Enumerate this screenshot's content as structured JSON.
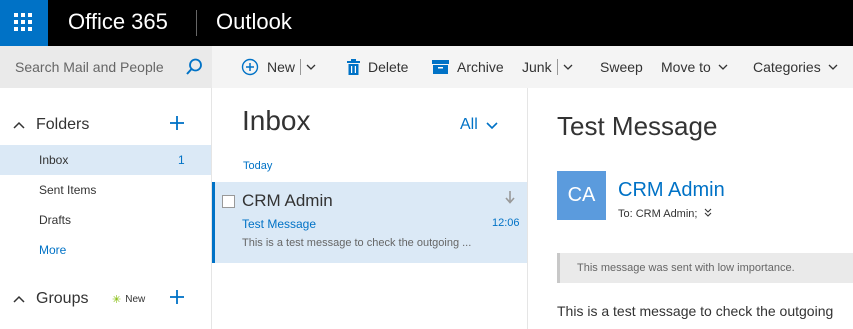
{
  "topbar": {
    "brand": "Office 365",
    "app_name": "Outlook",
    "waffle_icon": "app-launcher-icon",
    "accent": "#0072c6"
  },
  "search": {
    "placeholder": "Search Mail and People",
    "icon": "search-icon"
  },
  "toolbar": {
    "new_label": "New",
    "delete_label": "Delete",
    "archive_label": "Archive",
    "junk_label": "Junk",
    "sweep_label": "Sweep",
    "move_to_label": "Move to",
    "categories_label": "Categories"
  },
  "nav": {
    "folders_label": "Folders",
    "items": [
      {
        "label": "Inbox",
        "count": "1",
        "selected": true
      },
      {
        "label": "Sent Items",
        "count": ""
      },
      {
        "label": "Drafts",
        "count": ""
      }
    ],
    "more_label": "More",
    "groups_label": "Groups",
    "new_badge": "New"
  },
  "message_list": {
    "title": "Inbox",
    "filter_label": "All",
    "group_label": "Today",
    "messages": [
      {
        "from": "CRM Admin",
        "subject": "Test Message",
        "time": "12:06",
        "preview": "This is a test message to check the outgoing ..."
      }
    ]
  },
  "reading_pane": {
    "subject": "Test Message",
    "avatar_initials": "CA",
    "avatar_color": "#5b9bdd",
    "from": "CRM Admin",
    "to_line": "To: CRM Admin;",
    "importance_note": "This message was sent with low importance.",
    "body": "This is a test message to check the outgoing"
  }
}
